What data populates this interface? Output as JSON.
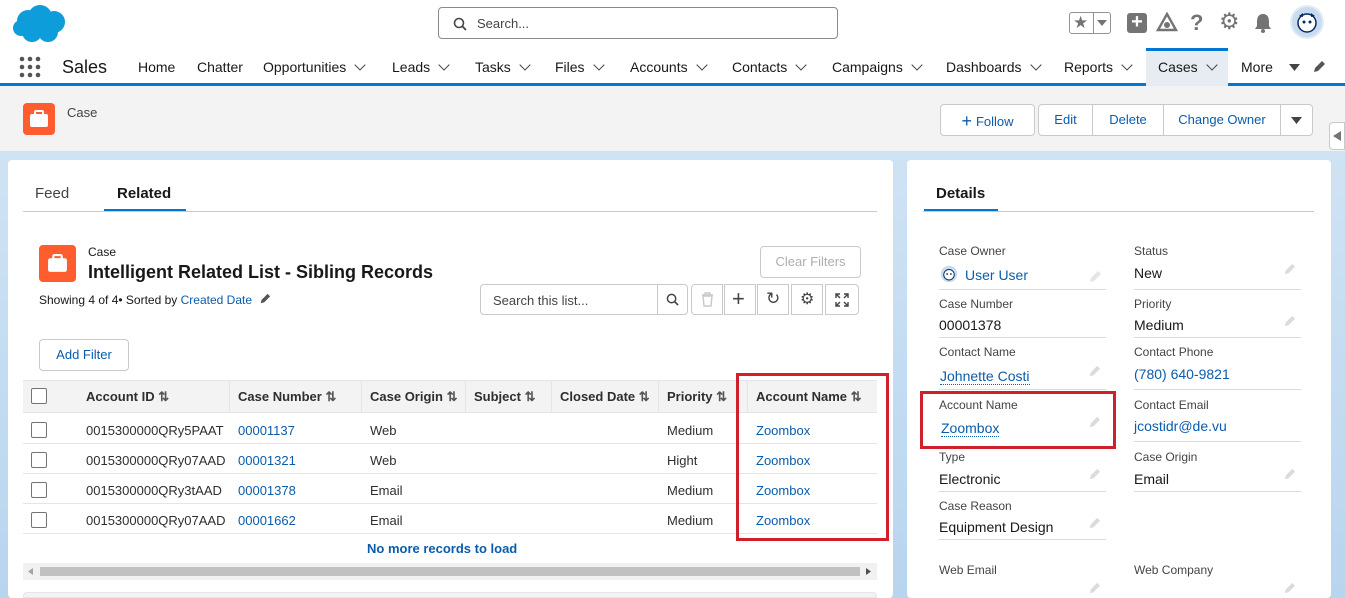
{
  "header": {
    "search_placeholder": "Search..."
  },
  "nav": {
    "app_name": "Sales",
    "items": [
      "Home",
      "Chatter",
      "Opportunities",
      "Leads",
      "Tasks",
      "Files",
      "Accounts",
      "Contacts",
      "Campaigns",
      "Dashboards",
      "Reports",
      "Cases",
      "More"
    ],
    "active": "Cases"
  },
  "record": {
    "object_label": "Case",
    "actions": {
      "follow": "Follow",
      "edit": "Edit",
      "delete": "Delete",
      "change_owner": "Change Owner"
    }
  },
  "tabs": {
    "feed": "Feed",
    "related": "Related"
  },
  "related_list": {
    "object_label": "Case",
    "title": "Intelligent Related List - Sibling Records",
    "summary_prefix": "Showing 4 of 4• Sorted by",
    "sorted_by": "Created Date",
    "clear_filters": "Clear Filters",
    "search_placeholder": "Search this list...",
    "add_filter": "Add Filter",
    "columns": [
      "Account ID",
      "Case Number",
      "Case Origin",
      "Subject",
      "Closed Date",
      "Priority",
      "Account Name"
    ],
    "rows": [
      {
        "account_id": "0015300000QRy5PAAT",
        "case_number": "00001137",
        "case_origin": "Web",
        "subject": "",
        "closed_date": "",
        "priority": "Medium",
        "account_name": "Zoombox"
      },
      {
        "account_id": "0015300000QRy07AAD",
        "case_number": "00001321",
        "case_origin": "Web",
        "subject": "",
        "closed_date": "",
        "priority": "Hight",
        "account_name": "Zoombox"
      },
      {
        "account_id": "0015300000QRy3tAAD",
        "case_number": "00001378",
        "case_origin": "Email",
        "subject": "",
        "closed_date": "",
        "priority": "Medium",
        "account_name": "Zoombox"
      },
      {
        "account_id": "0015300000QRy07AAD",
        "case_number": "00001662",
        "case_origin": "Email",
        "subject": "",
        "closed_date": "",
        "priority": "Medium",
        "account_name": "Zoombox"
      }
    ],
    "footer": "No more records to load"
  },
  "details": {
    "tab": "Details",
    "fields": {
      "case_owner": {
        "label": "Case Owner",
        "value": "User User"
      },
      "status": {
        "label": "Status",
        "value": "New"
      },
      "case_number": {
        "label": "Case Number",
        "value": "00001378"
      },
      "priority": {
        "label": "Priority",
        "value": "Medium"
      },
      "contact_name": {
        "label": "Contact Name",
        "value": "Johnette Costi"
      },
      "contact_phone": {
        "label": "Contact Phone",
        "value": "(780) 640-9821"
      },
      "account_name": {
        "label": "Account Name",
        "value": "Zoombox"
      },
      "contact_email": {
        "label": "Contact Email",
        "value": "jcostidr@de.vu"
      },
      "type": {
        "label": "Type",
        "value": "Electronic"
      },
      "case_origin": {
        "label": "Case Origin",
        "value": "Email"
      },
      "case_reason": {
        "label": "Case Reason",
        "value": "Equipment Design"
      },
      "web_email": {
        "label": "Web Email",
        "value": ""
      },
      "web_company": {
        "label": "Web Company",
        "value": ""
      }
    }
  },
  "colors": {
    "brand": "#0176d3",
    "case_icon": "#ff5d2d",
    "link": "#0b5cab",
    "highlight": "#d0202c"
  }
}
